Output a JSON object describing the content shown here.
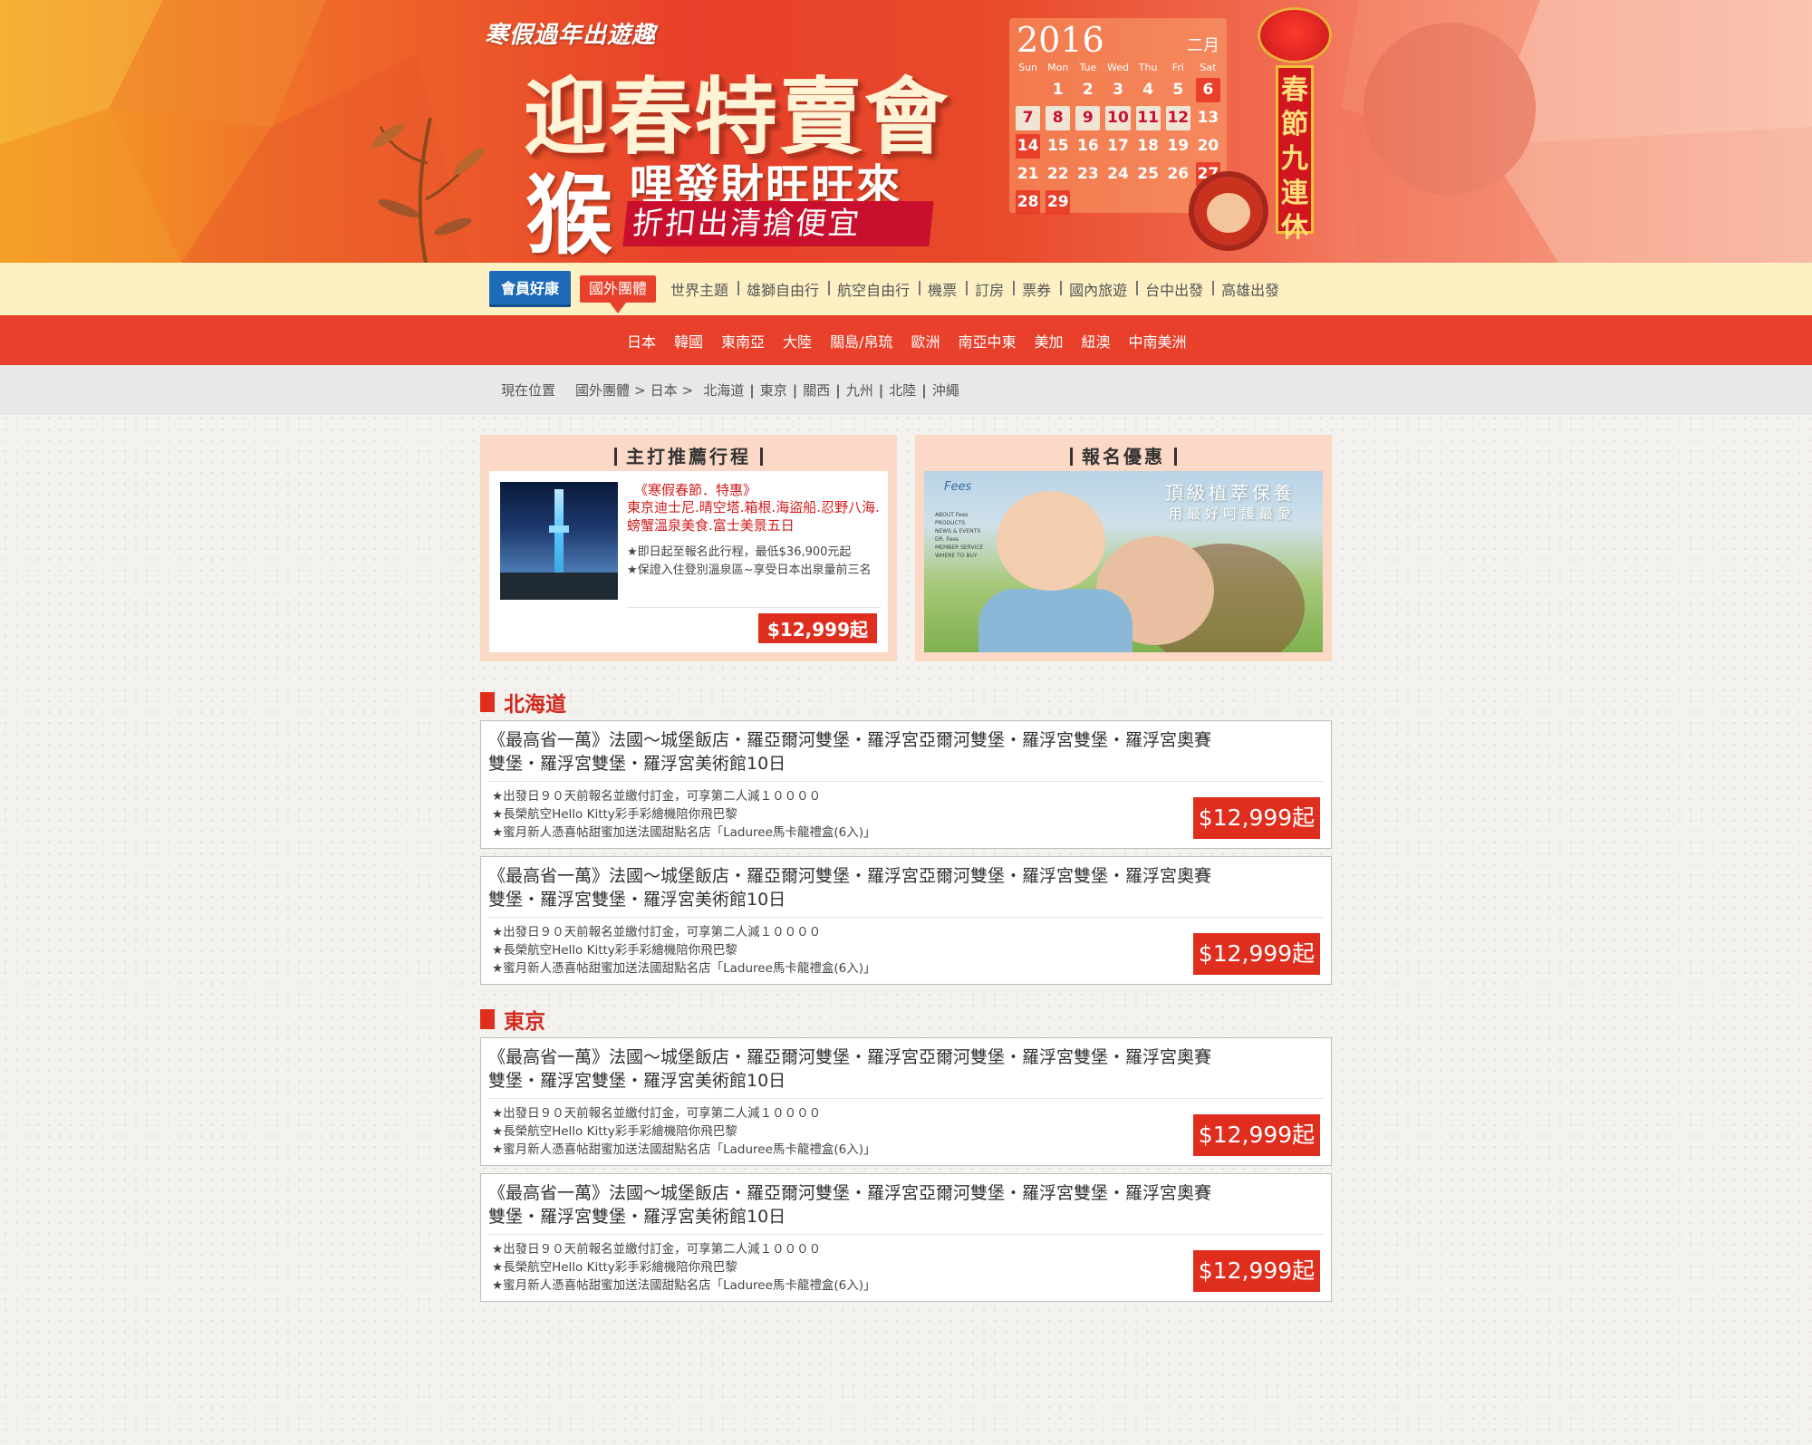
{
  "banner": {
    "subtitle": "寒假過年出遊趣",
    "title": "迎春特賣會",
    "monkey_char": "猴",
    "line2": "哩發財旺旺來",
    "line3": "折扣出清搶便宜",
    "calendar": {
      "year": "2016",
      "month": "二月",
      "weekdays": [
        "Sun",
        "Mon",
        "Tue",
        "Wed",
        "Thu",
        "Fri",
        "Sat"
      ],
      "days": [
        "",
        "1",
        "2",
        "3",
        "4",
        "5",
        "6",
        "7",
        "8",
        "9",
        "10",
        "11",
        "12",
        "13",
        "14",
        "15",
        "16",
        "17",
        "18",
        "19",
        "20",
        "21",
        "22",
        "23",
        "24",
        "25",
        "26",
        "27",
        "28",
        "29",
        "",
        "",
        "",
        "",
        ""
      ]
    },
    "couplet": "春節九連休"
  },
  "nav": {
    "member": "會員好康",
    "items": [
      "國外團體",
      "世界主題",
      "雄獅自由行",
      "航空自由行",
      "機票",
      "訂房",
      "票券",
      "國內旅遊",
      "台中出發",
      "高雄出發"
    ]
  },
  "subnav": [
    "日本",
    "韓國",
    "東南亞",
    "大陸",
    "關島/帛琉",
    "歐洲",
    "南亞中東",
    "美加",
    "紐澳",
    "中南美洲"
  ],
  "breadcrumb": {
    "label": "現在位置",
    "path": [
      "國外團體",
      "日本"
    ],
    "links": [
      "北海道",
      "東京",
      "關西",
      "九州",
      "北陸",
      "沖繩"
    ]
  },
  "featured": {
    "title": "主打推薦行程",
    "tag": "《寒假春節．特惠》",
    "name": "東京迪士尼.晴空塔.箱根.海盜船.忍野八海.螃蟹溫泉美食.富士美景五日",
    "bullets": [
      "★即日起至報名此行程，最低$36,900元起",
      "★保證入住登別溫泉區~享受日本出泉量前三名"
    ],
    "price": "$12,999起"
  },
  "promo": {
    "title": "報名優惠",
    "logo": "Fees",
    "headline": "頂級植萃保養",
    "subline": "用最好呵護最愛",
    "menu": [
      "ABOUT Fees",
      "PRODUCTS",
      "NEWS & EVENTS",
      "DR. Fees",
      "MEMBER SERVICE",
      "WHERE TO BUY"
    ]
  },
  "sections": [
    {
      "name": "北海道",
      "trips": [
        {
          "title": "《最高省一萬》法國～城堡飯店・羅亞爾河雙堡・羅浮宮亞爾河雙堡・羅浮宮雙堡・羅浮宮奧賽雙堡・羅浮宮雙堡・羅浮宮美術館10日",
          "bullets": [
            "★出發日９０天前報名並繳付訂金，可享第二人減１００００",
            "★長榮航空Hello Kitty彩手彩繪機陪你飛巴黎",
            "★蜜月新人憑喜帖甜蜜加送法國甜點名店「Laduree馬卡龍禮盒(6入)」"
          ],
          "price": "$12,999起"
        },
        {
          "title": "《最高省一萬》法國～城堡飯店・羅亞爾河雙堡・羅浮宮亞爾河雙堡・羅浮宮雙堡・羅浮宮奧賽雙堡・羅浮宮雙堡・羅浮宮美術館10日",
          "bullets": [
            "★出發日９０天前報名並繳付訂金，可享第二人減１００００",
            "★長榮航空Hello Kitty彩手彩繪機陪你飛巴黎",
            "★蜜月新人憑喜帖甜蜜加送法國甜點名店「Laduree馬卡龍禮盒(6入)」"
          ],
          "price": "$12,999起"
        }
      ]
    },
    {
      "name": "東京",
      "trips": [
        {
          "title": "《最高省一萬》法國～城堡飯店・羅亞爾河雙堡・羅浮宮亞爾河雙堡・羅浮宮雙堡・羅浮宮奧賽雙堡・羅浮宮雙堡・羅浮宮美術館10日",
          "bullets": [
            "★出發日９０天前報名並繳付訂金，可享第二人減１００００",
            "★長榮航空Hello Kitty彩手彩繪機陪你飛巴黎",
            "★蜜月新人憑喜帖甜蜜加送法國甜點名店「Laduree馬卡龍禮盒(6入)」"
          ],
          "price": "$12,999起"
        },
        {
          "title": "《最高省一萬》法國～城堡飯店・羅亞爾河雙堡・羅浮宮亞爾河雙堡・羅浮宮雙堡・羅浮宮奧賽雙堡・羅浮宮雙堡・羅浮宮美術館10日",
          "bullets": [
            "★出發日９０天前報名並繳付訂金，可享第二人減１００００",
            "★長榮航空Hello Kitty彩手彩繪機陪你飛巴黎",
            "★蜜月新人憑喜帖甜蜜加送法國甜點名店「Laduree馬卡龍禮盒(6入)」"
          ],
          "price": "$12,999起"
        }
      ]
    }
  ]
}
